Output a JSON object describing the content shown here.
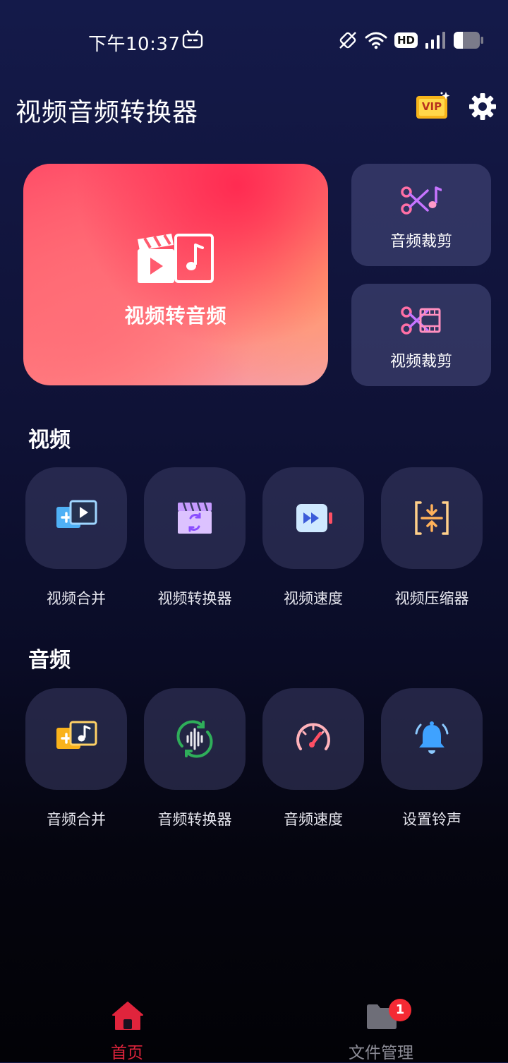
{
  "status_bar": {
    "time": "下午10:37",
    "hd": "HD"
  },
  "header": {
    "title": "视频音频转换器",
    "vip": "VIP"
  },
  "hero": {
    "label": "视频转音频"
  },
  "side_cards": [
    {
      "label": "音频裁剪"
    },
    {
      "label": "视频裁剪"
    }
  ],
  "sections": {
    "video": {
      "title": "视频",
      "items": [
        {
          "label": "视频合并",
          "icon": "video-merge-icon"
        },
        {
          "label": "视频转换器",
          "icon": "video-convert-icon"
        },
        {
          "label": "视频速度",
          "icon": "video-speed-icon"
        },
        {
          "label": "视频压缩器",
          "icon": "video-compress-icon"
        }
      ]
    },
    "audio": {
      "title": "音频",
      "items": [
        {
          "label": "音频合并",
          "icon": "audio-merge-icon"
        },
        {
          "label": "音频转换器",
          "icon": "audio-convert-icon"
        },
        {
          "label": "音频速度",
          "icon": "audio-speed-icon"
        },
        {
          "label": "设置铃声",
          "icon": "ringtone-bell-icon"
        }
      ]
    }
  },
  "bottom_nav": {
    "home": "首页",
    "files": "文件管理",
    "files_badge": "1"
  },
  "colors": {
    "accent_red": "#e0243c",
    "badge_red": "#f42a34"
  }
}
